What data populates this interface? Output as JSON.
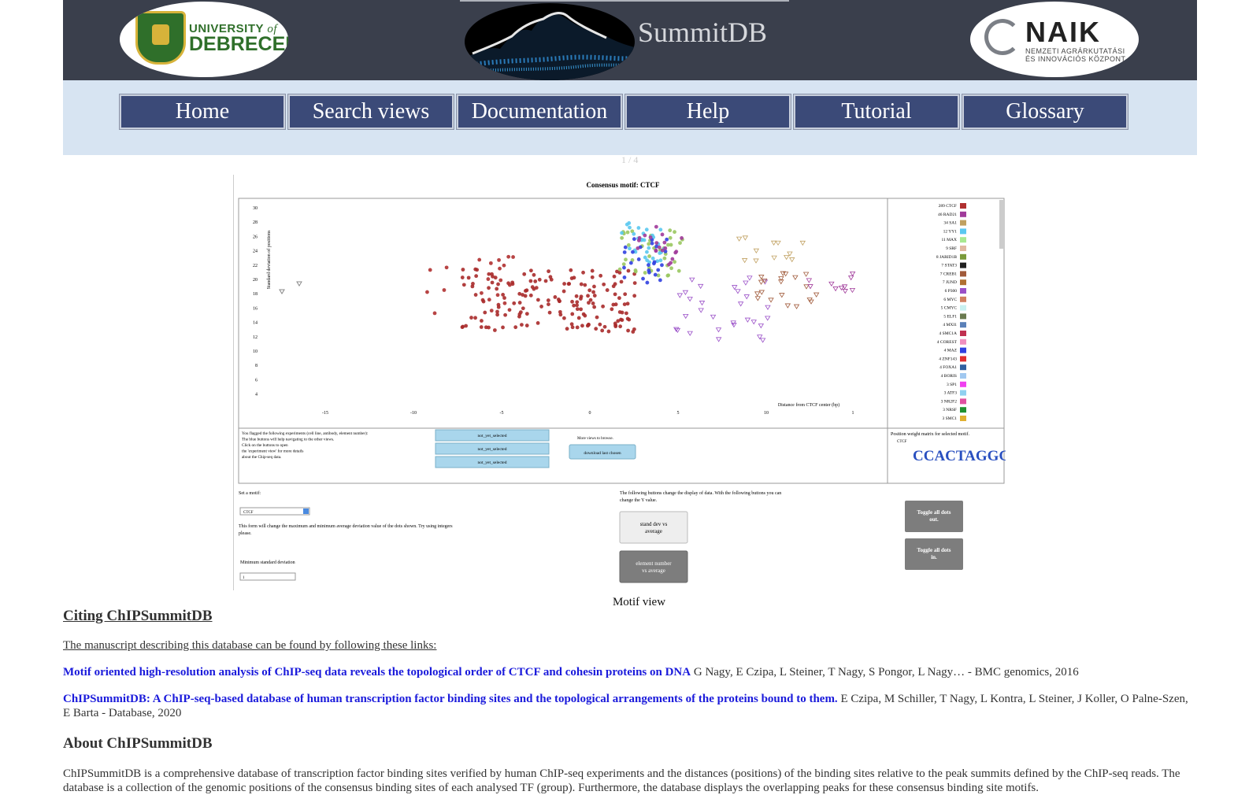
{
  "header": {
    "left_logo": {
      "line1": "UNIVERSITY",
      "line1_of": "of",
      "line2": "DEBRECEN"
    },
    "center_logo_text": "SummitDB",
    "right_logo": {
      "name": "NAIK",
      "sub1": "NEMZETI AGRÁRKUTATÁSI",
      "sub2": "ÉS INNOVÁCIÓS KÖZPONT"
    }
  },
  "nav": {
    "items": [
      "Home",
      "Search views",
      "Documentation",
      "Help",
      "Tutorial",
      "Glossary"
    ]
  },
  "slideshow": {
    "counter": "1 / 4",
    "caption": "Motif view"
  },
  "slide": {
    "title": "Consensus motif: CTCF",
    "ylabel": "Standard deviation of positions",
    "xlabel": "Distance from CTCF center (bp)",
    "yticks": [
      "30",
      "28",
      "26",
      "24",
      "22",
      "20",
      "18",
      "16",
      "14",
      "12",
      "10",
      "8",
      "6",
      "4"
    ],
    "xticks": [
      "-15",
      "-10",
      "-5",
      "0",
      "5",
      "10",
      "1"
    ],
    "legend": [
      {
        "label": "289 CTCF",
        "color": "#b03030"
      },
      {
        "label": "46 RAD21",
        "color": "#a03a9a"
      },
      {
        "label": "34 SA1",
        "color": "#c0a060"
      },
      {
        "label": "12 YY1",
        "color": "#5ac8f0"
      },
      {
        "label": "11 MAX",
        "color": "#a8e890"
      },
      {
        "label": "9 SRF",
        "color": "#e0b8a0"
      },
      {
        "label": "8 JARID1B",
        "color": "#7a9a3a"
      },
      {
        "label": "7 STAT3",
        "color": "#202020"
      },
      {
        "label": "7 CREB1",
        "color": "#a05a3a"
      },
      {
        "label": "7 JUND",
        "color": "#b07030"
      },
      {
        "label": "6 P300",
        "color": "#9a50c8"
      },
      {
        "label": "6 MYC",
        "color": "#d08060"
      },
      {
        "label": "5 CMYC",
        "color": "#c8f0f0"
      },
      {
        "label": "5 ELF1",
        "color": "#6a7a50"
      },
      {
        "label": "4 MXI1",
        "color": "#5a80b8"
      },
      {
        "label": "4 SMC1A",
        "color": "#c03050"
      },
      {
        "label": "4 COREST",
        "color": "#f090c0"
      },
      {
        "label": "4 MAZ",
        "color": "#3040e0"
      },
      {
        "label": "4 ZNF143",
        "color": "#e03030"
      },
      {
        "label": "4 FOXA1",
        "color": "#3060a0"
      },
      {
        "label": "4 BORIS",
        "color": "#a0c8f0"
      },
      {
        "label": "3 SP1",
        "color": "#f040f0"
      },
      {
        "label": "3 ATF3",
        "color": "#90d0f0"
      },
      {
        "label": "3 NR2F2",
        "color": "#e050a0"
      },
      {
        "label": "3 NRSF",
        "color": "#209030"
      },
      {
        "label": "3 SMC1",
        "color": "#e0b030"
      }
    ],
    "flag_text": [
      "You flagged the following experiments (cell line, antibody, element number):",
      "The blue buttons will help navigating to the other views.",
      "Click on the buttons to open",
      "the 'experiment view' for more details",
      "about the Chip-seq data."
    ],
    "not_selected": [
      "not_yet_selected",
      "not_yet_selected",
      "not_yet_selected"
    ],
    "more_views": "More views to browse.",
    "download": "download last chosen",
    "pwm_title": "Position weight matrix for selected motif.",
    "pwm_motif": "CTCF",
    "pwm_seq": "CCACTAGGGGC",
    "set_motif": "Set a motif:",
    "motif_value": "CTCF",
    "form_text": [
      "This form will change the maximum and minimum average deviation value of the dots shown. Try using integers",
      "please."
    ],
    "min_sd": "Minimum standard deviation",
    "min_sd_value": "1",
    "buttons_text": [
      "The following buttons change the display of data. With the following buttons you can",
      "change the Y value."
    ],
    "btn_sd": [
      "stand dev vs",
      "average"
    ],
    "btn_en": [
      "element number",
      "vs average"
    ],
    "toggle_out": [
      "Toggle all dots",
      "out."
    ],
    "toggle_in": [
      "Toggle all dots",
      "in."
    ]
  },
  "citing": {
    "heading": "Citing ChIPSummitDB",
    "intro": "The manuscript describing this database can be found by following these links:",
    "refs": [
      {
        "title": "Motif oriented high-resolution analysis of ChIP-seq data reveals the topological order of CTCF and cohesin proteins on DNA",
        "authors": " G Nagy, E Czipa, L Steiner, T Nagy, S Pongor, L Nagy… - BMC genomics, 2016"
      },
      {
        "title": "ChIPSummitDB: A ChIP-seq-based database of human transcription factor binding sites and the topological arrangements of the proteins bound to them.",
        "authors": " E Czipa, M Schiller, T Nagy, L Kontra, L Steiner, J Koller, O Palne-Szen, E Barta - Database, 2020"
      }
    ]
  },
  "about": {
    "heading": "About ChIPSummitDB",
    "text": "ChIPSummitDB is a comprehensive database of transcription factor binding sites verified by human ChIP-seq experiments and the distances (positions) of the binding sites relative to the peak summits defined by the ChIP-seq reads. The database is a collection of the genomic positions of the consensus binding sites of each analysed TF (group). Furthermore, the database displays the overlapping peaks for these consensus binding site motifs."
  },
  "colors": {
    "header_bg": "#3a3f4c",
    "nav_bg": "#d7e4f2",
    "nav_btn": "#3b4a78",
    "link": "#1a1adb"
  }
}
